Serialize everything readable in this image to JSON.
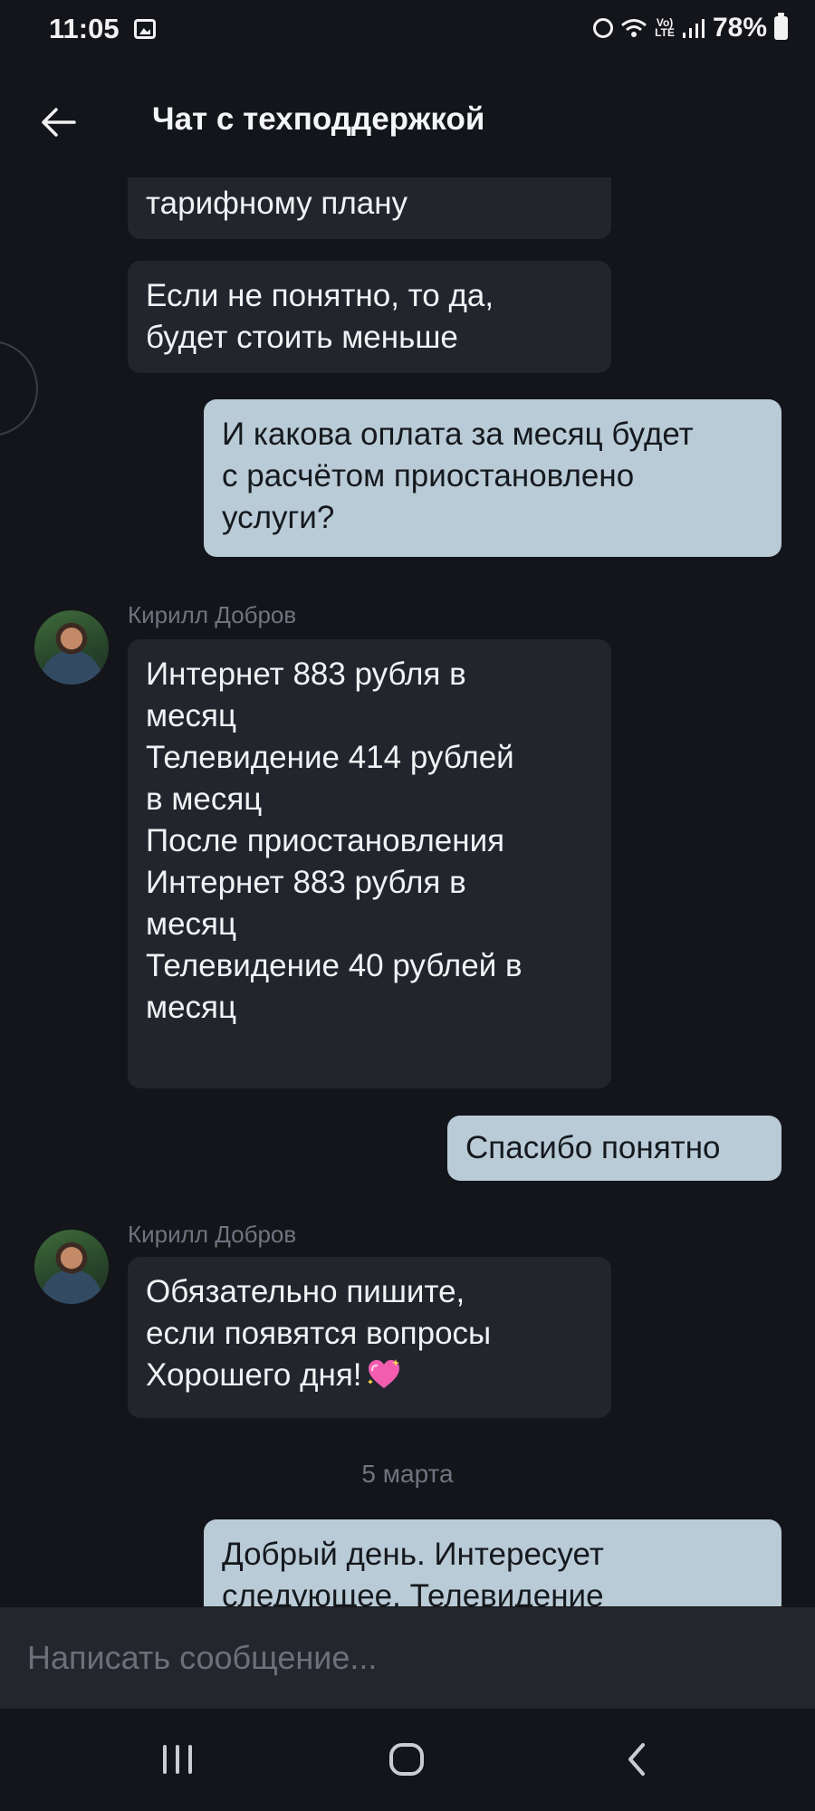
{
  "status_bar": {
    "time": "11:05",
    "lte_top": "Vo)",
    "lte_bottom": "LTE",
    "battery": "78%"
  },
  "header": {
    "title": "Чат с техподдержкой"
  },
  "messages": [
    {
      "direction": "incoming",
      "lines": [
        "тарифному плану"
      ]
    },
    {
      "direction": "incoming",
      "lines": [
        "Если не понятно, то да,",
        "будет стоить меньше"
      ]
    },
    {
      "direction": "outgoing",
      "lines": [
        "И какова оплата за месяц будет",
        "с расчётом приостановлено",
        "услуги?"
      ]
    },
    {
      "direction": "incoming",
      "sender": "Кирилл Добров",
      "lines": [
        "Интернет 883 рубля в",
        "месяц",
        "Телевидение 414 рублей",
        "в месяц",
        "После приостановления",
        "Интернет 883 рубля в",
        "месяц",
        "Телевидение 40 рублей в",
        "месяц"
      ]
    },
    {
      "direction": "outgoing",
      "lines": [
        "Спасибо понятно"
      ]
    },
    {
      "direction": "incoming",
      "sender": "Кирилл Добров",
      "lines": [
        "Обязательно пишите,",
        "если появятся вопросы",
        "Хорошего дня!"
      ]
    },
    {
      "direction": "outgoing",
      "lines": [
        "Добрый день. Интересует",
        "следующее. Телевидение"
      ]
    }
  ],
  "date_separator": "5 марта",
  "input": {
    "placeholder": "Написать сообщение..."
  },
  "colors": {
    "background": "#13151a",
    "incoming_bubble": "#23252d",
    "outgoing_bubble": "#b9cbd6",
    "muted_text": "#6f747f"
  },
  "icons": {
    "heart": "sparkling-heart-icon",
    "back": "arrow-left-icon"
  }
}
